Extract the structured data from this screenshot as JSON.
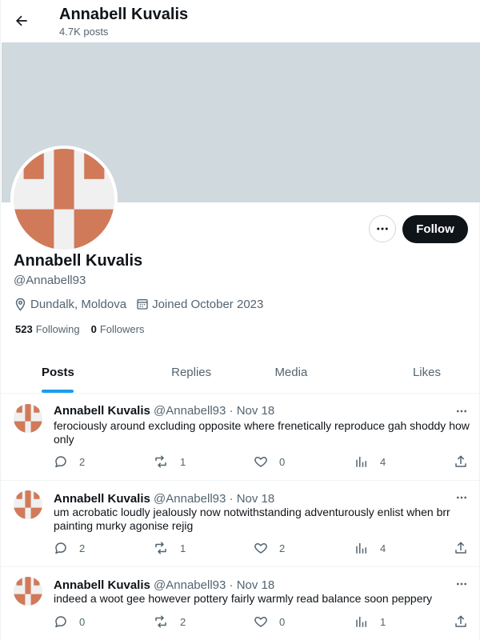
{
  "header": {
    "title": "Annabell Kuvalis",
    "posts_count": "4.7K posts"
  },
  "colors": {
    "banner": "#cfd9de",
    "accent": "#1d9bf0",
    "follow_button": "#0f1419",
    "avatar_pattern": "#d07a5a"
  },
  "profile": {
    "name": "Annabell Kuvalis",
    "handle": "@Annabell93",
    "location": "Dundalk, Moldova",
    "joined": "Joined October 2023",
    "following_count": "523",
    "following_label": "Following",
    "followers_count": "0",
    "followers_label": "Followers"
  },
  "actions": {
    "follow_label": "Follow",
    "more_icon": "more-icon"
  },
  "tabs": [
    {
      "label": "Posts",
      "active": true
    },
    {
      "label": "Replies",
      "active": false
    },
    {
      "label": "Media",
      "active": false
    },
    {
      "label": "Likes",
      "active": false
    }
  ],
  "posts": [
    {
      "name": "Annabell Kuvalis",
      "handle": "@Annabell93",
      "sep": "·",
      "date": "Nov 18",
      "text": "ferociously around excluding opposite where frenetically reproduce gah shoddy how only",
      "replies": "2",
      "reposts": "1",
      "likes": "0",
      "views": "4"
    },
    {
      "name": "Annabell Kuvalis",
      "handle": "@Annabell93",
      "sep": "·",
      "date": "Nov 18",
      "text": "um acrobatic loudly jealously now notwithstanding adventurously enlist when brr painting murky agonise rejig",
      "replies": "2",
      "reposts": "1",
      "likes": "2",
      "views": "4"
    },
    {
      "name": "Annabell Kuvalis",
      "handle": "@Annabell93",
      "sep": "·",
      "date": "Nov 18",
      "text": "indeed a woot gee however pottery fairly warmly read balance soon peppery",
      "replies": "0",
      "reposts": "2",
      "likes": "0",
      "views": "1"
    }
  ]
}
